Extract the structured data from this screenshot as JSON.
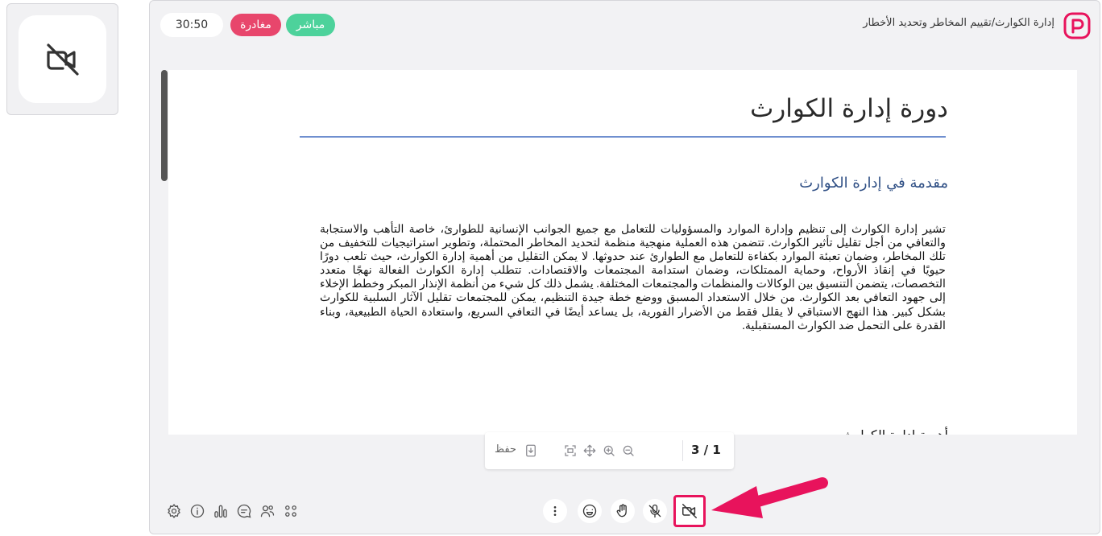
{
  "self_view": {
    "camera_state_icon": "camera-off-icon"
  },
  "header": {
    "timer": "30:50",
    "leave_label": "مغادرة",
    "live_label": "مباشر",
    "breadcrumb": "إدارة الكوارث/تقييم المخاطر وتحديد الأخطار",
    "logo_icon": "p-logo-icon"
  },
  "document": {
    "title": "دورة إدارة الكوارث",
    "heading": "مقدمة في إدارة الكوارث",
    "body": "تشير إدارة الكوارث إلى تنظيم وإدارة الموارد والمسؤوليات للتعامل مع جميع الجوانب الإنسانية للطوارئ، خاصة التأهب والاستجابة والتعافي من أجل تقليل تأثير الكوارث. تتضمن هذه العملية منهجية منظمة لتحديد المخاطر المحتملة، وتطوير استراتيجيات للتخفيف من تلك المخاطر، وضمان تعبئة الموارد بكفاءة للتعامل مع الطوارئ عند حدوثها. لا يمكن التقليل من أهمية إدارة الكوارث، حيث تلعب دورًا حيويًا في إنقاذ الأرواح، وحماية الممتلكات، وضمان استدامة المجتمعات والاقتصادات. تتطلب إدارة الكوارث الفعالة نهجًا متعدد التخصصات، يتضمن التنسيق بين الوكالات والمنظمات والمجتمعات المختلفة. يشمل ذلك كل شيء من أنظمة الإنذار المبكر وخطط الإخلاء إلى جهود التعافي بعد الكوارث. من خلال الاستعداد المسبق ووضع خطة جيدة التنظيم، يمكن للمجتمعات تقليل الآثار السلبية للكوارث بشكل كبير. هذا النهج الاستباقي لا يقلل فقط من الأضرار الفورية، بل يساعد أيضًا في التعافي السريع، واستعادة الحياة الطبيعية، وبناء القدرة على التحمل ضد الكوارث المستقبلية.",
    "partial_heading": "أهمية إدارة الكوارث"
  },
  "doc_toolbar": {
    "save_label": "حفظ",
    "page_indicator": "3 / 1",
    "icons": [
      "download-icon",
      "fit-screen-icon",
      "move-icon",
      "zoom-in-icon",
      "zoom-out-icon"
    ]
  },
  "bottom_bar": {
    "left_icons": [
      "settings-icon",
      "info-icon",
      "stats-icon",
      "chat-icon",
      "participants-icon",
      "apps-grid-icon"
    ],
    "controls": [
      "more-icon",
      "emoji-icon",
      "raise-hand-icon",
      "mic-off-icon",
      "camera-off-icon"
    ],
    "highlight_color": "#e8135c"
  },
  "colors": {
    "live": "#4dd29b",
    "leave": "#e8466c",
    "rule": "#6f8fcf",
    "heading": "#2e4e84",
    "logo": "#e8135c"
  }
}
